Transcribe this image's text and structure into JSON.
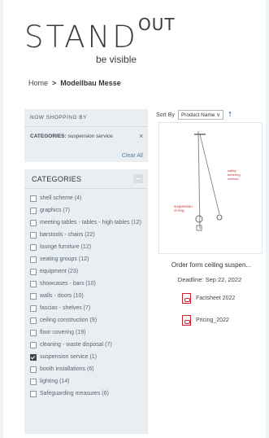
{
  "logo": {
    "main": "STAND",
    "sup": "OUT",
    "tagline": "be visible"
  },
  "breadcrumb": {
    "home": "Home",
    "separator": ">",
    "current": "Modellbau Messe"
  },
  "shopping": {
    "header": "NOW SHOPPING BY",
    "criterion_label": "CATEGORIES:",
    "criterion_value": "suspension service",
    "remove": "×",
    "clear_all": "Clear All"
  },
  "categories": {
    "header": "CATEGORIES",
    "items": [
      {
        "label": "shell scheme (4)",
        "checked": false
      },
      {
        "label": "graphics (7)",
        "checked": false
      },
      {
        "label": "meeting tables - tables - high tables (12)",
        "checked": false
      },
      {
        "label": "barstools - chairs (22)",
        "checked": false
      },
      {
        "label": "lounge furniture (12)",
        "checked": false
      },
      {
        "label": "seating groups (12)",
        "checked": false
      },
      {
        "label": "equipment (23)",
        "checked": false
      },
      {
        "label": "showcases - bars (10)",
        "checked": false
      },
      {
        "label": "walls - doors (10)",
        "checked": false
      },
      {
        "label": "fascias - shelves (7)",
        "checked": false
      },
      {
        "label": "ceiling construction (9)",
        "checked": false
      },
      {
        "label": "floor covering (19)",
        "checked": false
      },
      {
        "label": "cleaning - waste disposal (7)",
        "checked": false
      },
      {
        "label": "suspension service (1)",
        "checked": true
      },
      {
        "label": "booth installations (6)",
        "checked": false
      },
      {
        "label": "lighting (14)",
        "checked": false
      },
      {
        "label": "Safeguarding measures (6)",
        "checked": false
      }
    ]
  },
  "sort": {
    "label": "Sort By",
    "value": "Product Name ∨",
    "direction_icon": "arrow-up-icon"
  },
  "product": {
    "name": "Order form ceiling suspen...",
    "deadline": "Deadline: Sep 22, 2022",
    "files": [
      "Factsheet 2022",
      "Pricing_2022"
    ]
  },
  "colors": {
    "accent": "#3a7bd5",
    "panel": "#e8eef2",
    "background": "#eef3f6"
  }
}
